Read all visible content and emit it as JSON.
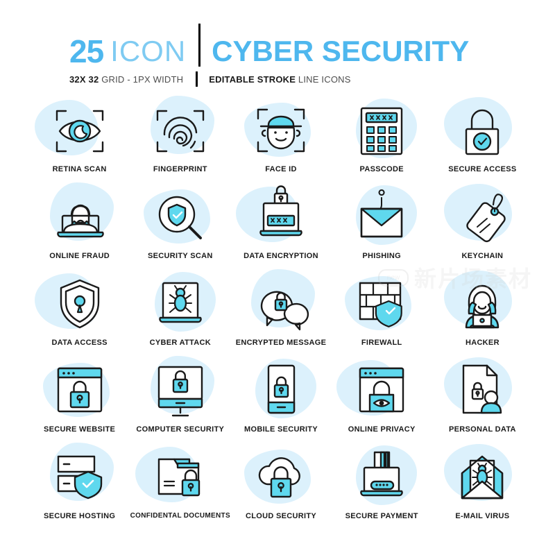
{
  "header": {
    "count": "25",
    "icon_word": "ICON",
    "title": "CYBER SECURITY",
    "sub_left_bold": "32X 32",
    "sub_left_light": "GRID - 1PX WIDTH",
    "sub_right_bold": "EDITABLE STROKE",
    "sub_right_light": "LINE ICONS"
  },
  "colors": {
    "accent_blue": "#4EB7EE",
    "cyan_fill": "#5FD8EE",
    "light_cyan_fill": "#9FE8F5",
    "blob_bg": "#DCF1FC",
    "stroke_dark": "#1a1a1a",
    "white": "#ffffff"
  },
  "watermark": {
    "badge": "new",
    "text": "新片场素材"
  },
  "icons": [
    {
      "id": "retina-scan",
      "label": "RETINA SCAN",
      "glyph": "retina-scan-icon"
    },
    {
      "id": "fingerprint",
      "label": "FINGERPRINT",
      "glyph": "fingerprint-icon"
    },
    {
      "id": "face-id",
      "label": "FACE ID",
      "glyph": "face-id-icon"
    },
    {
      "id": "passcode",
      "label": "PASSCODE",
      "glyph": "passcode-keypad-icon"
    },
    {
      "id": "secure-access",
      "label": "SECURE ACCESS",
      "glyph": "padlock-check-icon"
    },
    {
      "id": "online-fraud",
      "label": "ONLINE FRAUD",
      "glyph": "laptop-person-icon"
    },
    {
      "id": "security-scan",
      "label": "SECURITY SCAN",
      "glyph": "magnifier-shield-icon"
    },
    {
      "id": "data-encryption",
      "label": "DATA ENCRYPTION",
      "glyph": "laptop-password-lock-icon"
    },
    {
      "id": "phishing",
      "label": "PHISHING",
      "glyph": "envelope-hook-icon"
    },
    {
      "id": "keychain",
      "label": "KEYCHAIN",
      "glyph": "key-tag-icon"
    },
    {
      "id": "data-access",
      "label": "DATA ACCESS",
      "glyph": "shield-keyhole-icon"
    },
    {
      "id": "cyber-attack",
      "label": "CYBER ATTACK",
      "glyph": "laptop-bug-icon"
    },
    {
      "id": "encrypted-message",
      "label": "ENCRYPTED MESSAGE",
      "glyph": "chat-bubbles-lock-icon"
    },
    {
      "id": "firewall",
      "label": "FIREWALL",
      "glyph": "brick-wall-shield-icon"
    },
    {
      "id": "hacker",
      "label": "HACKER",
      "glyph": "hooded-hacker-icon"
    },
    {
      "id": "secure-website",
      "label": "SECURE WEBSITE",
      "glyph": "browser-lock-icon"
    },
    {
      "id": "computer-security",
      "label": "COMPUTER SECURITY",
      "glyph": "monitor-lock-icon"
    },
    {
      "id": "mobile-security",
      "label": "MOBILE SECURITY",
      "glyph": "phone-lock-icon"
    },
    {
      "id": "online-privacy",
      "label": "ONLINE PRIVACY",
      "glyph": "browser-lock-eye-icon"
    },
    {
      "id": "personal-data",
      "label": "PERSONAL DATA",
      "glyph": "document-person-lock-icon"
    },
    {
      "id": "secure-hosting",
      "label": "SECURE HOSTING",
      "glyph": "server-shield-icon"
    },
    {
      "id": "confidental-documents",
      "label": "CONFIDENTAL DOCUMENTS",
      "glyph": "folder-lock-icon"
    },
    {
      "id": "cloud-security",
      "label": "CLOUD SECURITY",
      "glyph": "cloud-lock-icon"
    },
    {
      "id": "secure-payment",
      "label": "SECURE PAYMENT",
      "glyph": "card-reader-icon"
    },
    {
      "id": "e-mail-virus",
      "label": "E-MAIL VIRUS",
      "glyph": "open-envelope-bug-icon"
    }
  ]
}
